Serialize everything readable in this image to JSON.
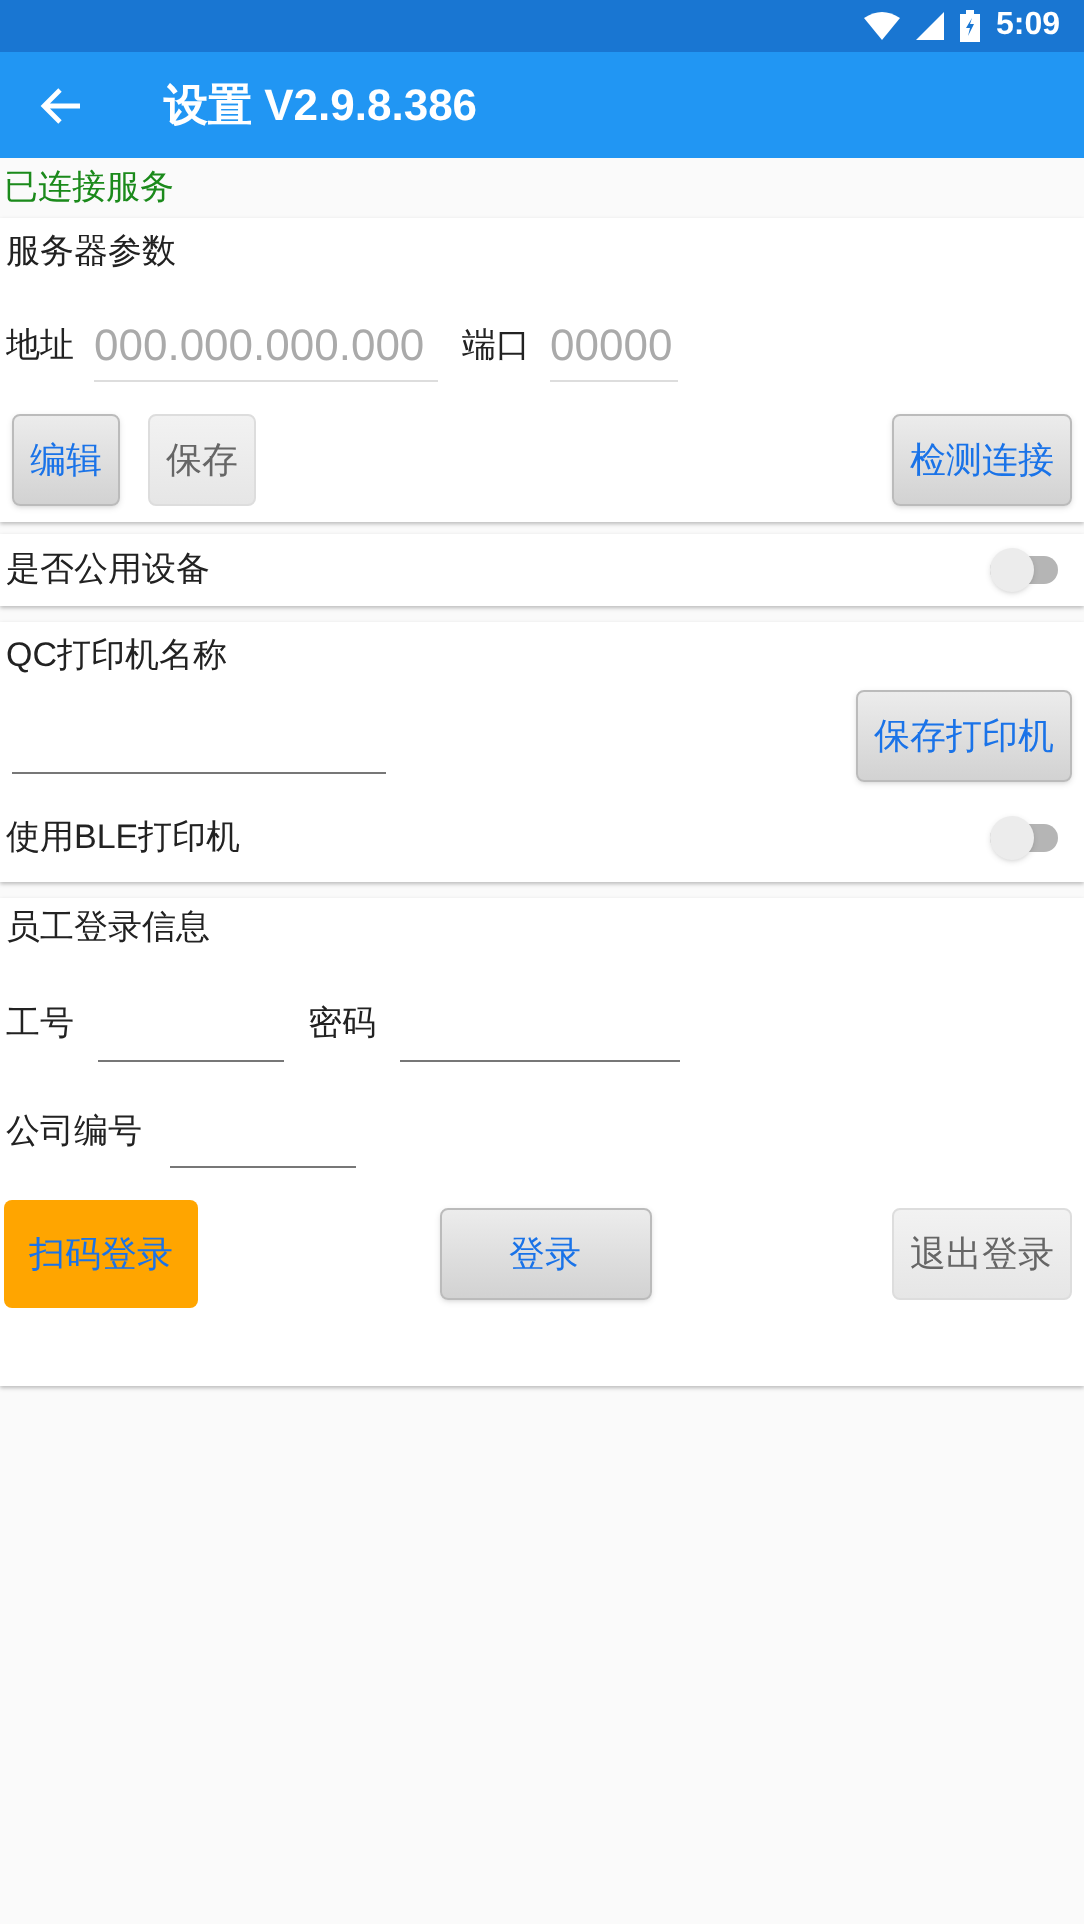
{
  "status_bar": {
    "time": "5:09"
  },
  "app_bar": {
    "title": "设置 V2.9.8.386"
  },
  "connection_status": "已连接服务",
  "server": {
    "title": "服务器参数",
    "address_label": "地址",
    "address": {
      "placeholder": "000.000.000.000"
    },
    "port_label": "端口",
    "port": {
      "placeholder": "00000"
    },
    "buttons": [
      {
        "label": "编辑",
        "disabled": false
      },
      {
        "label": "保存",
        "disabled": true
      },
      {
        "label": "检测连接",
        "disabled": false
      }
    ]
  },
  "public_device": {
    "label": "是否公用设备",
    "on": false
  },
  "printer": {
    "title": "QC打印机名称",
    "save_button": {
      "label": "保存打印机",
      "disabled": false
    },
    "ble_label": "使用BLE打印机",
    "ble_on": false
  },
  "login": {
    "title": "员工登录信息",
    "id_label": "工号",
    "password_label": "密码",
    "company_label": "公司编号",
    "buttons": [
      {
        "label": "扫码登录",
        "kind": "accent",
        "disabled": false
      },
      {
        "label": "登录",
        "kind": "normal",
        "disabled": false
      },
      {
        "label": "退出登录",
        "kind": "normal",
        "disabled": true
      }
    ]
  }
}
